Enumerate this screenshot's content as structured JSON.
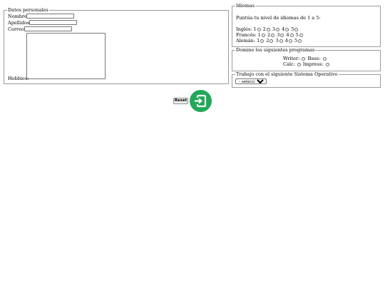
{
  "personal": {
    "legend": "Datos personales",
    "nombre_label": "Nombre:",
    "apellidos_label": "Apellidos:",
    "correo_label": "Correo:",
    "hobbies_label": "Hobbies:",
    "nombre_value": "",
    "apellidos_value": "",
    "correo_value": "",
    "hobbies_value": ""
  },
  "idiomas": {
    "legend": "Idiomas",
    "prompt": "Puntúa tu nivel de idiomas de 1 a 5:",
    "rows": [
      {
        "label": "Inglés:",
        "levels": [
          "1",
          "2",
          "3",
          "4",
          "5"
        ]
      },
      {
        "label": "Francés:",
        "levels": [
          "1",
          "2",
          "3",
          "4",
          "5"
        ]
      },
      {
        "label": "Alemán:",
        "levels": [
          "1",
          "2",
          "3",
          "4",
          "5"
        ]
      }
    ]
  },
  "programas": {
    "legend": "Domino los siguientes programas",
    "writer": "Writer:",
    "base": "Base:",
    "calc": "Calc:",
    "impress": "Impress:"
  },
  "sistema": {
    "legend": "Trabajo con el siguiente Sistema Operativo",
    "selected": "- selecciona -"
  },
  "actions": {
    "reset_label": "Reset",
    "submit_icon": "login-icon",
    "submit_color": "#22a85a"
  }
}
